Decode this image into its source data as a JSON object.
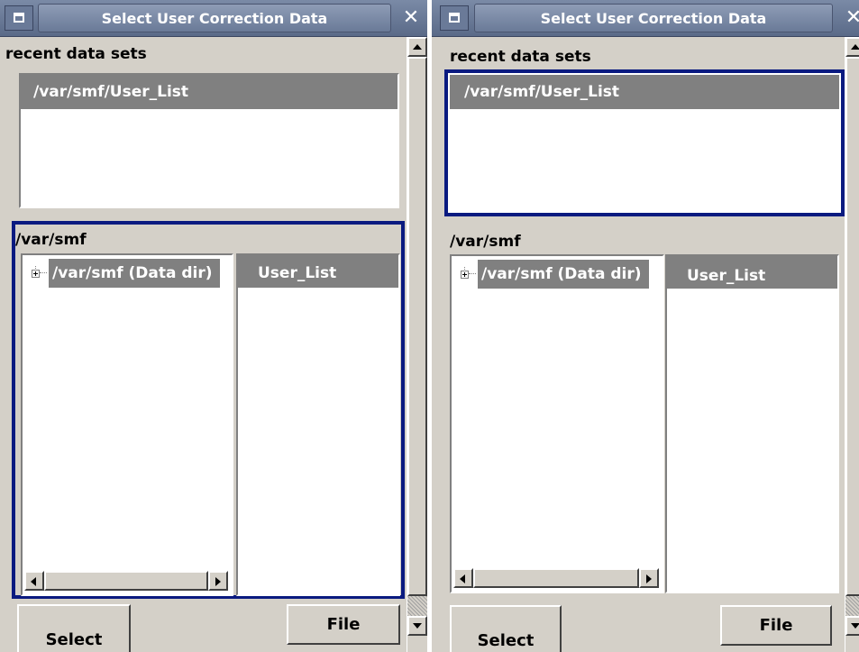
{
  "dialog": {
    "title": "Select User Correction Data",
    "close_glyph": "✕",
    "recent_label": "recent data sets",
    "recent_items": [
      "/var/smf/User_List"
    ],
    "path_label": "/var/smf",
    "tree_node_label": "/var/smf (Data dir)",
    "file_items": [
      "User_List"
    ],
    "select_button": "Select",
    "file_button": "File"
  },
  "focus_note_colors": {
    "focus_border": "#0a1a80",
    "titlebar": "#6a7a98",
    "selection": "#808080",
    "panel": "#d4d0c8"
  },
  "icons": {
    "system_menu": "window-menu-icon",
    "close": "close-icon",
    "tree_expander": "plus-expander-icon",
    "scroll_up": "up-arrow-icon",
    "scroll_down": "down-arrow-icon",
    "scroll_left": "left-arrow-icon",
    "scroll_right": "right-arrow-icon"
  }
}
